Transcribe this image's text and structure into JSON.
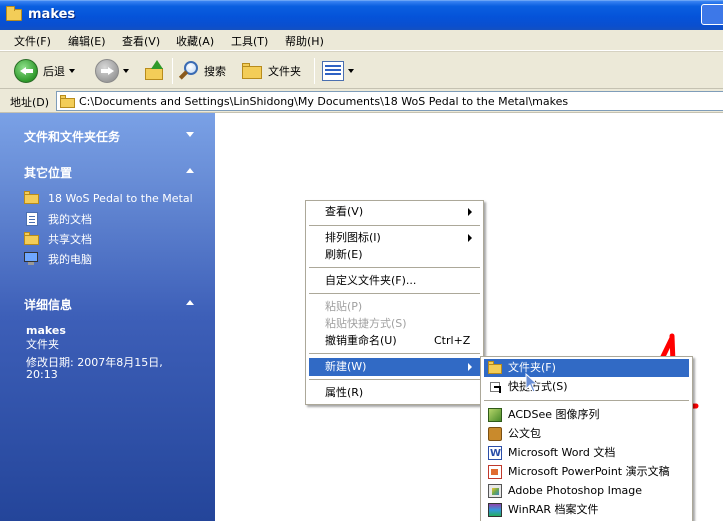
{
  "window": {
    "title": "makes"
  },
  "menubar": {
    "items": [
      "文件(F)",
      "编辑(E)",
      "查看(V)",
      "收藏(A)",
      "工具(T)",
      "帮助(H)"
    ]
  },
  "toolbar": {
    "back_label": "后退",
    "search_label": "搜索",
    "folders_label": "文件夹"
  },
  "address": {
    "label": "地址(D)",
    "value": "C:\\Documents and Settings\\LinShidong\\My Documents\\18 WoS Pedal to the Metal\\makes"
  },
  "taskpane": {
    "file_tasks_header": "文件和文件夹任务",
    "other_places_header": "其它位置",
    "other_places": [
      {
        "label": "18 WoS Pedal to the Metal",
        "icon": "folder-icon"
      },
      {
        "label": "我的文档",
        "icon": "my-documents-icon"
      },
      {
        "label": "共享文档",
        "icon": "folder-icon"
      },
      {
        "label": "我的电脑",
        "icon": "my-computer-icon"
      }
    ],
    "details_header": "详细信息",
    "details_name": "makes",
    "details_type": "文件夹",
    "details_modified_line1": "修改日期: 2007年8月15日,",
    "details_modified_line2": "20:13"
  },
  "context_menu": {
    "view": "查看(V)",
    "arrange": "排列图标(I)",
    "refresh": "刷新(E)",
    "customize": "自定义文件夹(F)...",
    "paste": "粘贴(P)",
    "paste_shortcut": "粘贴快捷方式(S)",
    "undo_rename": "撤销重命名(U)",
    "undo_shortcut": "Ctrl+Z",
    "new": "新建(W)",
    "properties": "属性(R)"
  },
  "new_submenu": {
    "items": [
      "文件夹(F)",
      "快捷方式(S)",
      "ACDSee 图像序列",
      "公文包",
      "Microsoft Word 文档",
      "Microsoft PowerPoint 演示文稿",
      "Adobe Photoshop Image",
      "WinRAR 档案文件"
    ]
  },
  "annotation": {
    "text": "4",
    "color": "#ff0000"
  },
  "colors": {
    "selection": "#316ac5",
    "titlebar": "#0553d9",
    "taskpane": "#3d5fb8"
  }
}
